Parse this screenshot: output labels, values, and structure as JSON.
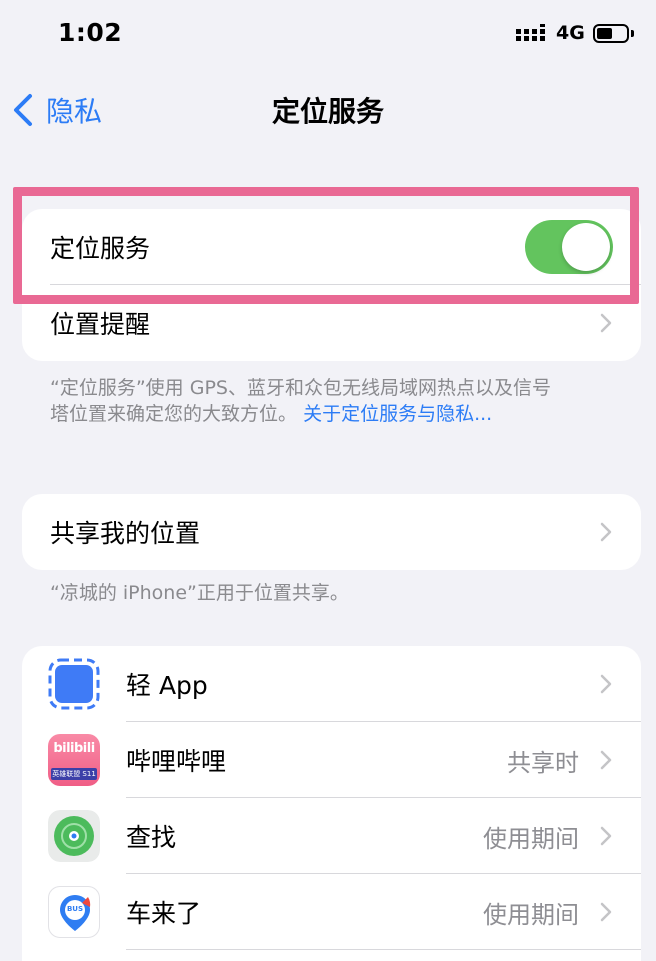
{
  "status_bar": {
    "time": "1:02",
    "network": "4G",
    "battery_level": 0.55
  },
  "nav": {
    "back_label": "隐私",
    "title": "定位服务"
  },
  "location_group": {
    "toggle_label": "定位服务",
    "toggle_on": true,
    "reminder_label": "位置提醒"
  },
  "location_footer": {
    "text_line1": "“定位服务”使用 GPS、蓝牙和众包无线局域网热点以及信号",
    "text_line2": "塔位置来确定您的大致方位。",
    "link": "关于定位服务与隐私..."
  },
  "share_group": {
    "label": "共享我的位置"
  },
  "share_footer": {
    "text": "“凉城的 iPhone”正用于位置共享。"
  },
  "apps": [
    {
      "name": "轻 App",
      "value": "",
      "icon": "light-app-icon",
      "color": "#3f7bf6"
    },
    {
      "name": "哔哩哔哩",
      "value": "共享时",
      "icon": "bilibili-icon",
      "color": "#f46c8f",
      "icon_text": "bilibili",
      "icon_subtext": "英雄联盟 S11"
    },
    {
      "name": "查找",
      "value": "使用期间",
      "icon": "find-my-icon",
      "color": "#4cbb5c"
    },
    {
      "name": "车来了",
      "value": "使用期间",
      "icon": "bus-app-icon",
      "color": "#2f7df2",
      "icon_text": "BUS"
    }
  ],
  "colors": {
    "accent": "#2c7cf6",
    "toggle_on": "#63c45e",
    "highlight": "#e96994"
  }
}
